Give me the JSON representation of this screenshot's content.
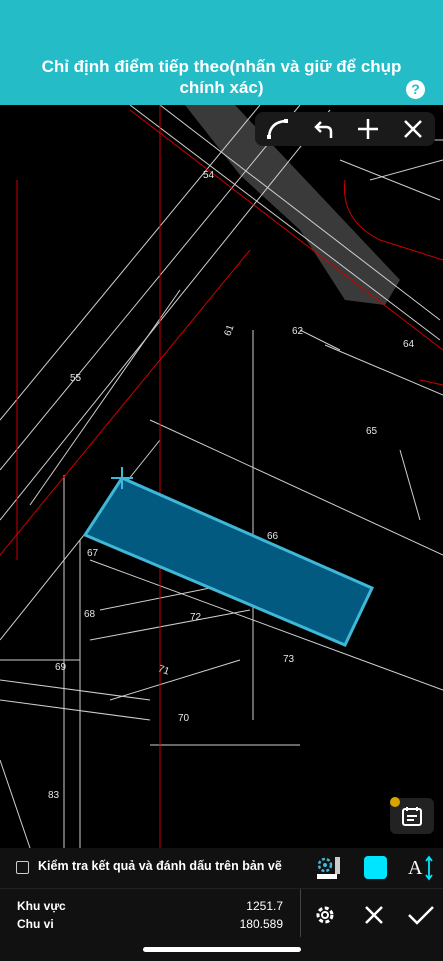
{
  "header": {
    "title": "Chỉ định điểm tiếp theo(nhấn và giữ để chụp chính xác)",
    "help_icon": "question-icon"
  },
  "toolbar": {
    "items": [
      {
        "name": "arc-tool",
        "icon": "arc-icon"
      },
      {
        "name": "undo",
        "icon": "undo-icon"
      },
      {
        "name": "add-point",
        "icon": "plus-icon"
      },
      {
        "name": "close",
        "icon": "close-icon"
      }
    ]
  },
  "map": {
    "parcel_labels": [
      "54",
      "61",
      "62",
      "64",
      "55",
      "65",
      "66",
      "67",
      "68",
      "72",
      "69",
      "71",
      "73",
      "70",
      "83"
    ],
    "selection_color": "#035a80",
    "selection_border": "#3fb8d8"
  },
  "check_row": {
    "label": "Kiểm tra kết quả và đánh dấu trên bản vẽ",
    "checked": false,
    "color_swatch": "#00e5ff"
  },
  "stats": {
    "area_label": "Khu vực",
    "area_value": "1251.7",
    "perimeter_label": "Chu vi",
    "perimeter_value": "180.589"
  },
  "colors": {
    "accent": "#24bcc7"
  }
}
